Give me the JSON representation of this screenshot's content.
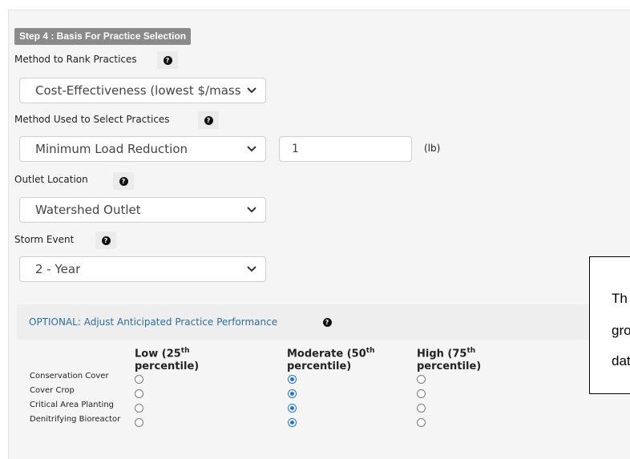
{
  "step": {
    "badge": "Step 4 : Basis For Practice Selection"
  },
  "fields": {
    "rank_method": {
      "label": "Method to Rank Practices",
      "value": "Cost-Effectiveness (lowest $/mass"
    },
    "select_method": {
      "label": "Method Used to Select Practices",
      "value": "Minimum Load Reduction",
      "amount": "1",
      "unit": "(lb)"
    },
    "outlet": {
      "label": "Outlet Location",
      "value": "Watershed Outlet"
    },
    "storm": {
      "label": "Storm Event",
      "value": "2 - Year"
    }
  },
  "help_icon_glyph": "?",
  "optional": {
    "title": "OPTIONAL: Adjust Anticipated Practice Performance",
    "columns": [
      {
        "line1": "Low (25",
        "sup": "th",
        "line2": "percentile)"
      },
      {
        "line1": "Moderate (50",
        "sup": "th",
        "line2": "percentile)"
      },
      {
        "line1": "High (75",
        "sup": "th",
        "line2": "percentile)"
      }
    ],
    "rows": [
      {
        "name": "Conservation Cover",
        "selected": "Moderate"
      },
      {
        "name": "Cover Crop",
        "selected": "Moderate"
      },
      {
        "name": "Critical Area Planting",
        "selected": "Moderate"
      },
      {
        "name": "Denitrifying Bioreactor",
        "selected": "Moderate"
      }
    ]
  },
  "note": {
    "lines": [
      "Th",
      "gro",
      "dat"
    ]
  },
  "colors": {
    "accent": "#1a73e8",
    "badge": "#8a8a8a",
    "link": "#2b6ea3"
  }
}
